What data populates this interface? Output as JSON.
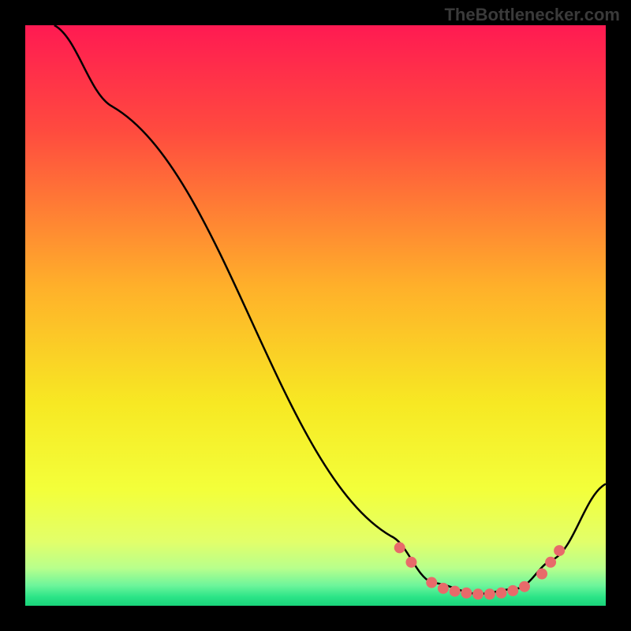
{
  "watermark": "TheBottlenecker.com",
  "chart_data": {
    "type": "line",
    "title": "",
    "xlabel": "",
    "ylabel": "",
    "xlim": [
      0,
      100
    ],
    "ylim": [
      0,
      100
    ],
    "series": [
      {
        "name": "curve",
        "points": [
          {
            "x": 5,
            "y": 100
          },
          {
            "x": 15,
            "y": 86
          },
          {
            "x": 63,
            "y": 12
          },
          {
            "x": 70,
            "y": 4
          },
          {
            "x": 78,
            "y": 2
          },
          {
            "x": 85,
            "y": 3
          },
          {
            "x": 91,
            "y": 8
          },
          {
            "x": 100,
            "y": 21
          }
        ]
      }
    ],
    "markers": [
      {
        "x": 64.5,
        "y": 10
      },
      {
        "x": 66.5,
        "y": 7.5
      },
      {
        "x": 70,
        "y": 4
      },
      {
        "x": 72,
        "y": 3.0
      },
      {
        "x": 74,
        "y": 2.5
      },
      {
        "x": 76,
        "y": 2.2
      },
      {
        "x": 78,
        "y": 2.0
      },
      {
        "x": 80,
        "y": 2.0
      },
      {
        "x": 82,
        "y": 2.2
      },
      {
        "x": 84,
        "y": 2.6
      },
      {
        "x": 86,
        "y": 3.3
      },
      {
        "x": 89,
        "y": 5.5
      },
      {
        "x": 90.5,
        "y": 7.5
      },
      {
        "x": 92,
        "y": 9.5
      }
    ],
    "gradient_stops": [
      {
        "offset": 0,
        "color": "#ff1a52"
      },
      {
        "offset": 0.18,
        "color": "#ff4a3f"
      },
      {
        "offset": 0.45,
        "color": "#ffb02a"
      },
      {
        "offset": 0.65,
        "color": "#f7e823"
      },
      {
        "offset": 0.8,
        "color": "#f3ff3a"
      },
      {
        "offset": 0.89,
        "color": "#e2ff6a"
      },
      {
        "offset": 0.935,
        "color": "#b8ff8c"
      },
      {
        "offset": 0.965,
        "color": "#6df59b"
      },
      {
        "offset": 0.985,
        "color": "#2be487"
      },
      {
        "offset": 1.0,
        "color": "#19d47a"
      }
    ],
    "marker_color": "#e86a6a",
    "curve_color": "#000000"
  }
}
